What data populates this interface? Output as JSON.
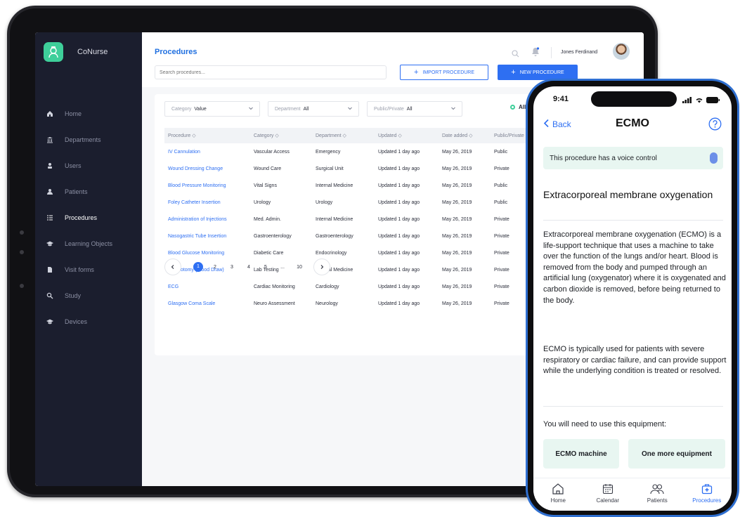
{
  "app": {
    "name": "CoNurse"
  },
  "sidebar": {
    "items": [
      {
        "label": "Home",
        "icon": "home-icon"
      },
      {
        "label": "Departments",
        "icon": "building-icon"
      },
      {
        "label": "Users",
        "icon": "user-icon"
      },
      {
        "label": "Patients",
        "icon": "patients-icon"
      },
      {
        "label": "Procedures",
        "icon": "list-icon",
        "active": true
      },
      {
        "label": "Learning Objects",
        "icon": "graduation-cap-icon"
      },
      {
        "label": "Visit forms",
        "icon": "document-icon"
      },
      {
        "label": "Study",
        "icon": "search-icon"
      },
      {
        "label": "Devices",
        "icon": "graduation-cap-icon"
      }
    ]
  },
  "header": {
    "title": "Procedures",
    "search_placeholder": "Search procedures...",
    "import_label": "IMPORT PROCEDURE",
    "new_label": "NEW PROCEDURE",
    "user_name": "Jones Ferdinand"
  },
  "filters": {
    "category": {
      "label": "Category",
      "value": "Value"
    },
    "department": {
      "label": "Department",
      "value": "All"
    },
    "public_private": {
      "label": "Public/Private",
      "value": "All"
    },
    "all_label": "All"
  },
  "table": {
    "columns": [
      "Procedure ◇",
      "Category ◇",
      "Department ◇",
      "Updated ◇",
      "Date added ◇",
      "Public/Private"
    ],
    "rows": [
      [
        "IV Cannulation",
        "Vascular Access",
        "Emergency",
        "Updated 1 day ago",
        "May 26, 2019",
        "Public"
      ],
      [
        "Wound Dressing Change",
        "Wound Care",
        "Surgical Unit",
        "Updated 1 day ago",
        "May 26, 2019",
        "Private"
      ],
      [
        "Blood Pressure Monitoring",
        "Vital Signs",
        "Internal Medicine",
        "Updated 1 day ago",
        "May 26, 2019",
        "Public"
      ],
      [
        "Foley Catheter Insertion",
        "Urology",
        "Urology",
        "Updated 1 day ago",
        "May 26, 2019",
        "Public"
      ],
      [
        "Administration of Injections",
        "Med. Admin.",
        "Internal Medicine",
        "Updated 1 day ago",
        "May 26, 2019",
        "Private"
      ],
      [
        "Nasogastric Tube Insertion",
        "Gastroenterology",
        "Gastroenterology",
        "Updated 1 day ago",
        "May 26, 2019",
        "Private"
      ],
      [
        "Blood Glucose Monitoring",
        "Diabetic Care",
        "Endocrinology",
        "Updated 1 day ago",
        "May 26, 2019",
        "Private"
      ],
      [
        "Phlebotomy (Blood Draw)",
        "Lab Testing",
        "Internal Medicine",
        "Updated 1 day ago",
        "May 26, 2019",
        "Private"
      ],
      [
        "ECG",
        "Cardiac Monitoring",
        "Cardiology",
        "Updated 1 day ago",
        "May 26, 2019",
        "Private"
      ],
      [
        "Glasgow Coma Scale",
        "Neuro Assessment",
        "Neurology",
        "Updated 1 day ago",
        "May 26, 2019",
        "Private"
      ]
    ]
  },
  "pagination": {
    "pages": [
      "1",
      "2",
      "3",
      "4",
      "5",
      "...",
      "10"
    ],
    "current": "1"
  },
  "phone": {
    "time": "9:41",
    "back_label": "Back",
    "title": "ECMO",
    "voice_banner": "This procedure has a voice control",
    "section_title": "Extracorporeal membrane oxygenation",
    "paragraph1": "Extracorporeal membrane oxygenation (ECMO) is a life-support technique that uses a machine to take over the function of the lungs and/or heart. Blood is removed from the body and pumped through an artificial lung (oxygenator) where it is oxygenated and carbon dioxide is removed, before being returned to the body.",
    "paragraph2": "ECMO is typically used for patients with severe respiratory or cardiac failure, and can provide support while the underlying condition is treated or resolved.",
    "equipment_label": "You will need to use this equipment:",
    "equipment": [
      "ECMO machine",
      "One more equipment"
    ],
    "tabs": [
      {
        "label": "Home",
        "icon": "home-icon"
      },
      {
        "label": "Calendar",
        "icon": "calendar-icon"
      },
      {
        "label": "Patients",
        "icon": "patients-icon"
      },
      {
        "label": "Procedures",
        "icon": "medical-kit-icon",
        "active": true
      }
    ]
  },
  "colors": {
    "accent": "#2e6ff2",
    "sidebar": "#1b1e2e",
    "brand_green": "#3ecf9a",
    "phone_frame": "#2f6fd0"
  }
}
